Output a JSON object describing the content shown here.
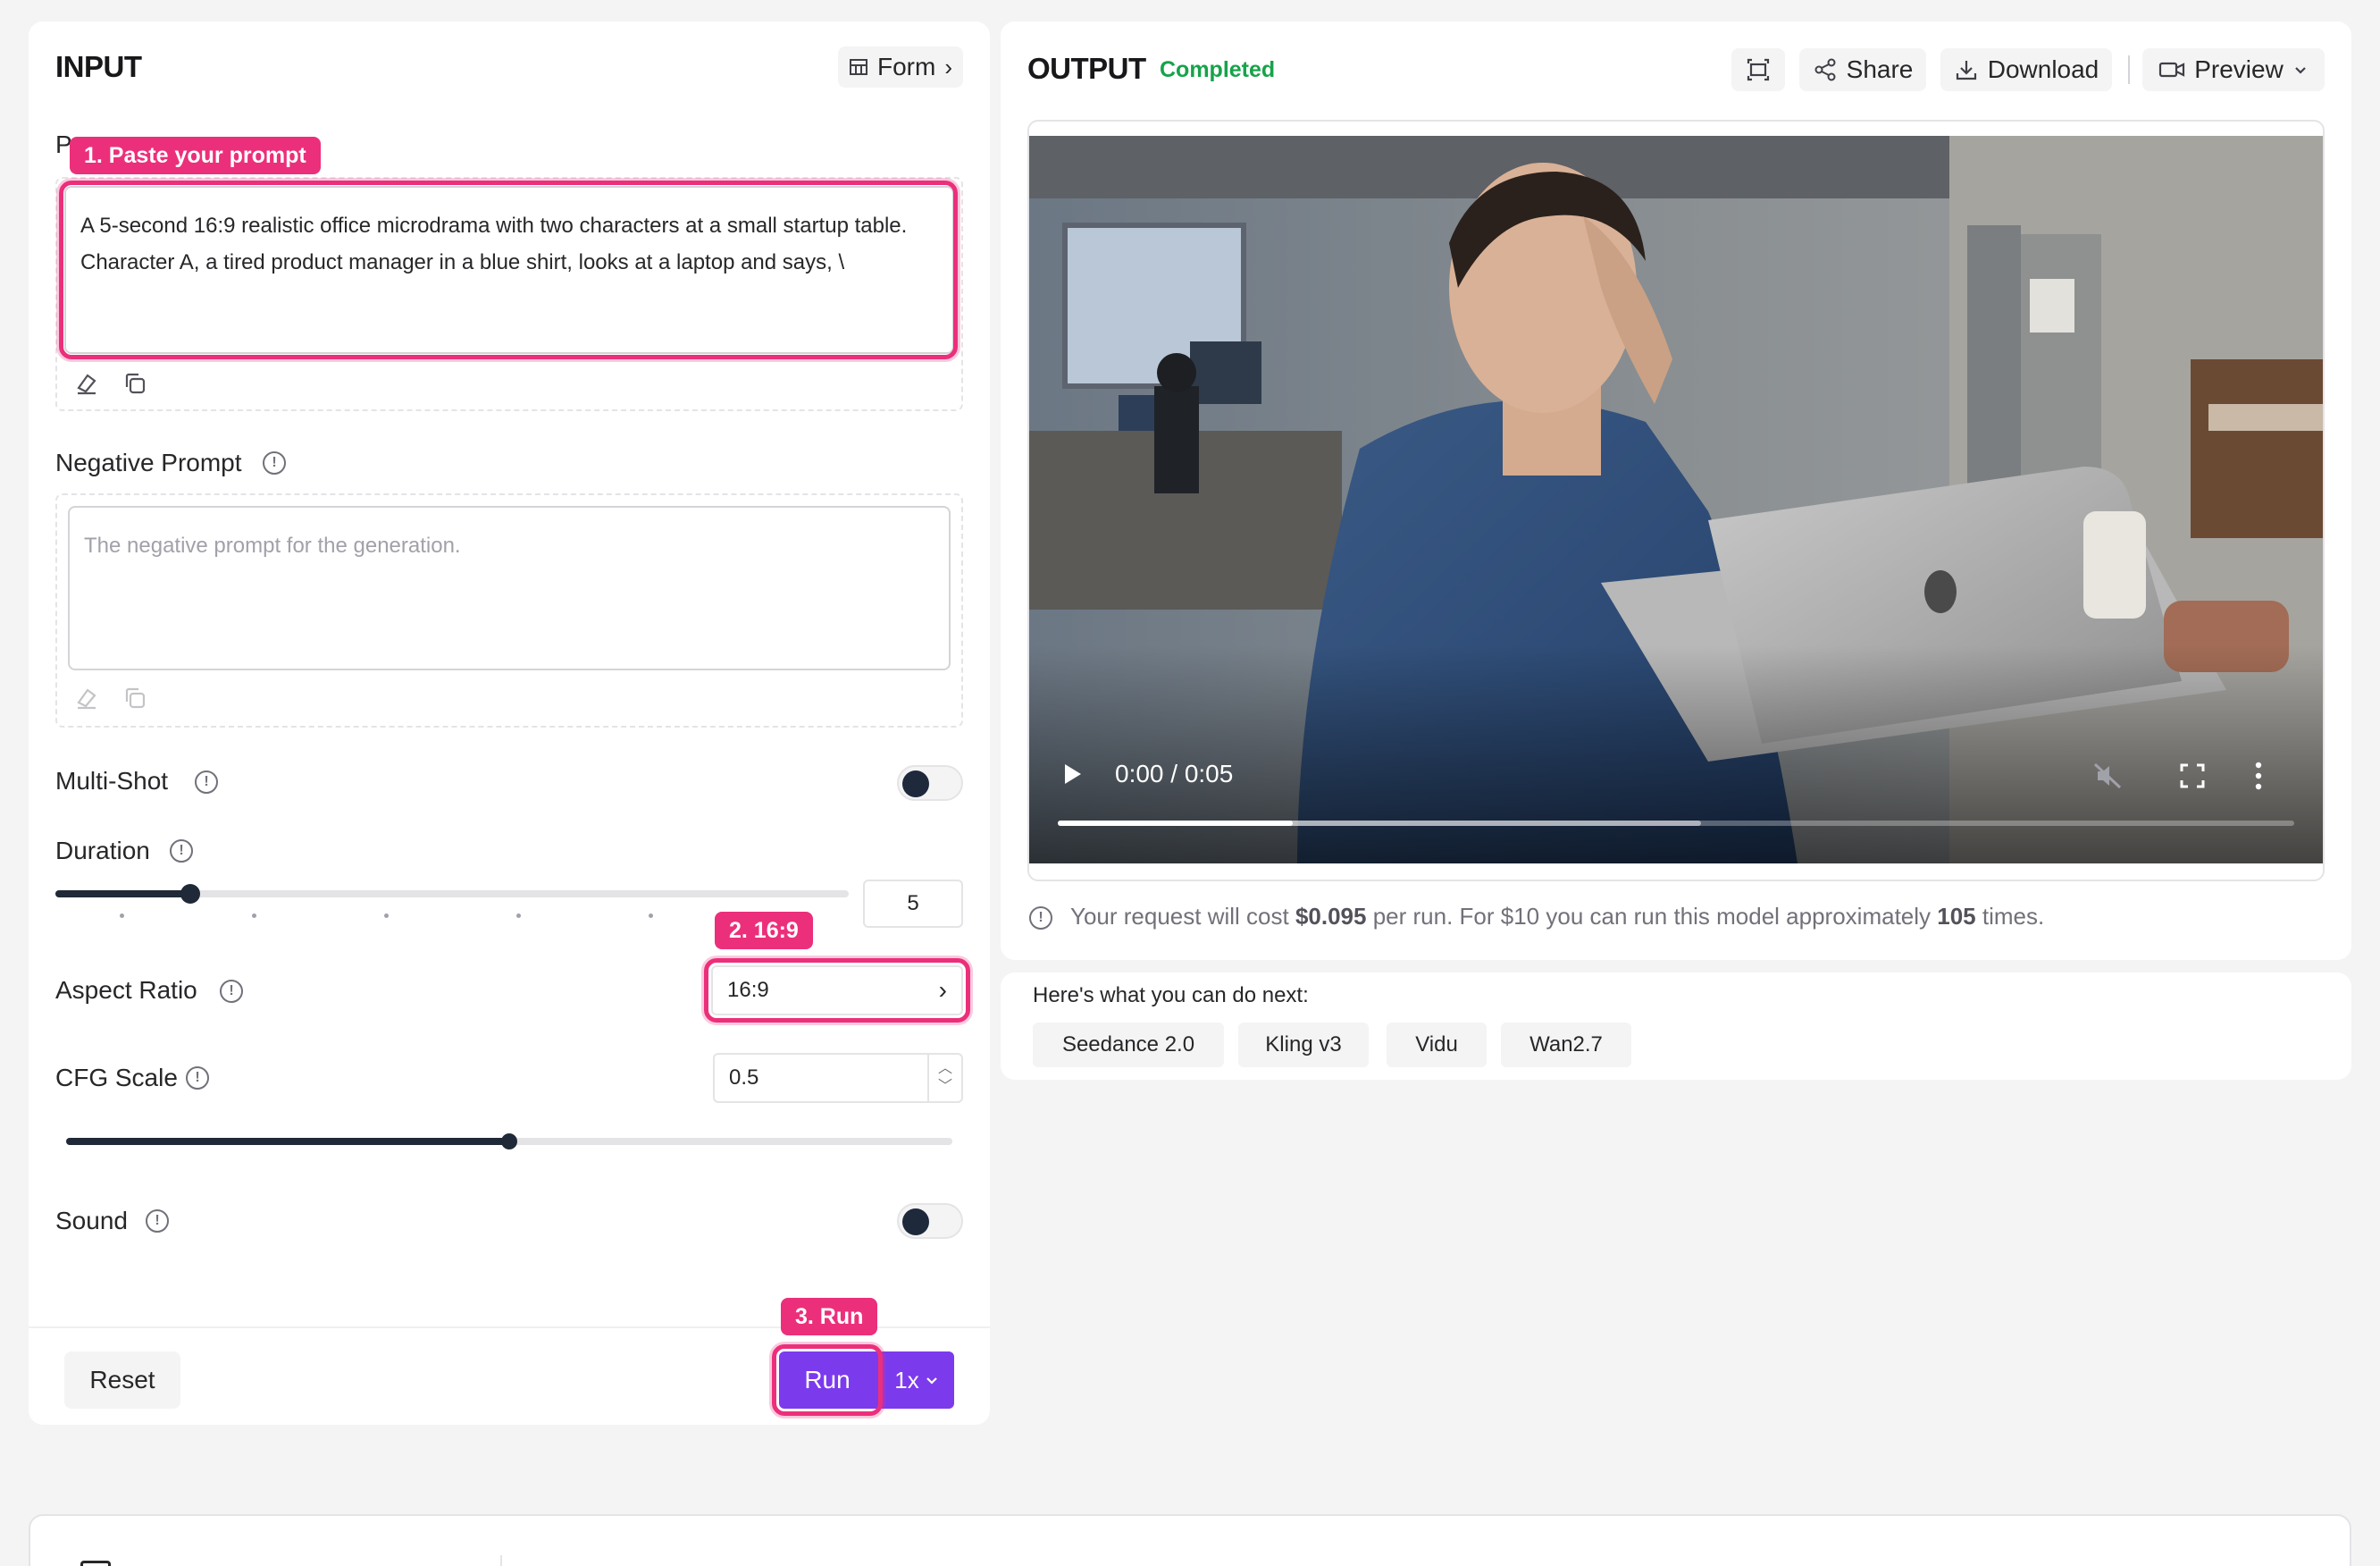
{
  "input": {
    "title": "INPUT",
    "form_button": "Form",
    "prompt_label": "Prompt",
    "prompt_value": "A 5-second 16:9 realistic office microdrama with two characters at a small startup table. Character A, a tired product manager in a blue shirt, looks at a laptop and says, \\",
    "negative_prompt_label": "Negative Prompt",
    "negative_prompt_placeholder": "The negative prompt for the generation.",
    "multi_shot_label": "Multi-Shot",
    "multi_shot_on": false,
    "duration_label": "Duration",
    "duration_value": "5",
    "duration_fraction": 0.17,
    "aspect_ratio_label": "Aspect Ratio",
    "aspect_ratio_value": "16:9",
    "cfg_label": "CFG Scale",
    "cfg_value": "0.5",
    "cfg_fraction": 0.5,
    "sound_label": "Sound",
    "sound_on": false,
    "reset_button": "Reset",
    "run_button": "Run",
    "run_count": "1x"
  },
  "callouts": {
    "step1": "1. Paste your prompt",
    "step2": "2. 16:9",
    "step3": "3. Run"
  },
  "output": {
    "title": "OUTPUT",
    "status": "Completed",
    "share_button": "Share",
    "download_button": "Download",
    "preview_button": "Preview",
    "video_time": "0:00 / 0:05",
    "video_played_fraction": 0.19,
    "video_buffered_fraction": 0.52,
    "cost_text_prefix": "Your request will cost ",
    "cost_value": "$0.095",
    "cost_text_mid": " per run. For $10 you can run this model approximately ",
    "runs_value": "105",
    "cost_text_suffix": " times."
  },
  "next": {
    "heading": "Here's what you can do next:",
    "chips": [
      "Seedance 2.0",
      "Kling v3",
      "Vidu",
      "Wan2.7"
    ]
  },
  "colors": {
    "accent_purple": "#7c3aed",
    "callout_pink": "#ec2f7b",
    "status_green": "#16a34a"
  }
}
